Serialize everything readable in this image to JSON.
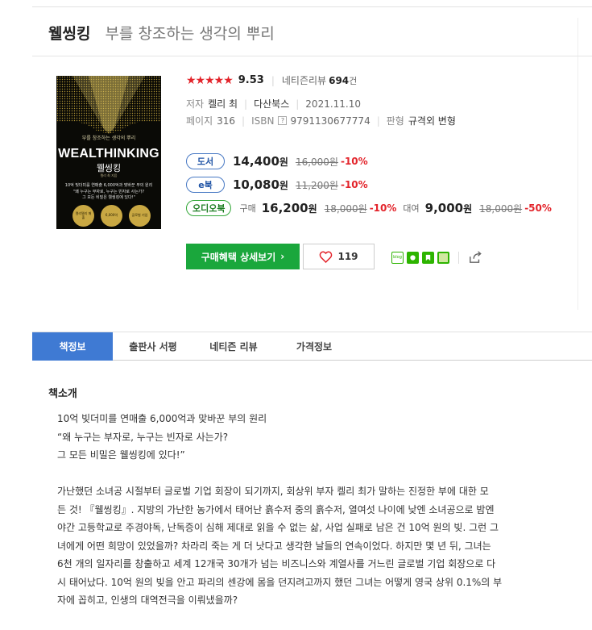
{
  "book": {
    "title": "웰씽킹",
    "subtitle": "부를 창조하는 생각의 뿌리"
  },
  "cover": {
    "small_text": "부를 창조하는 생각의 뿌리",
    "title_en": "WEALTHINKING",
    "title_kr": "웰씽킹",
    "author": "켈리 최 지음",
    "line1": "10억 빚더미를 연매출 6,000억과 맞바꾼 부의 원리",
    "line2": "\"왜 누구는 부자로, 누구는 빈자로 사는가?",
    "line3": "그 모든 비밀은 웰씽킹에 있다!\"",
    "badges": [
      "켈리델리 매출",
      "6,000억",
      "글로벌 기업"
    ]
  },
  "rating": {
    "stars": "★★★★★",
    "score": "9.53",
    "review_label": "네티즌리뷰",
    "review_count": "694",
    "review_unit": "건"
  },
  "meta": {
    "author_label": "저자",
    "author": "켈리 최",
    "publisher": "다산북스",
    "date": "2021.11.10",
    "pages_label": "페이지",
    "pages": "316",
    "isbn_label": "ISBN",
    "isbn_help": "?",
    "isbn": "9791130677774",
    "format_label": "판형",
    "format": "규격외 변형"
  },
  "prices": {
    "book": {
      "badge": "도서",
      "price": "14,400",
      "unit": "원",
      "original": "16,000원",
      "discount": "-10%"
    },
    "ebook": {
      "badge": "e북",
      "price": "10,080",
      "unit": "원",
      "original": "11,200원",
      "discount": "-10%"
    },
    "audio": {
      "badge": "오디오북",
      "buy_label": "구매",
      "buy_price": "16,200",
      "buy_unit": "원",
      "buy_original": "18,000원",
      "buy_discount": "-10%",
      "rent_label": "대여",
      "rent_price": "9,000",
      "rent_unit": "원",
      "rent_original": "18,000원",
      "rent_discount": "-50%"
    }
  },
  "actions": {
    "cta_label": "구매혜택 상세보기",
    "cta_arrow": "›",
    "like_count": "119",
    "blog_label": "blog"
  },
  "tabs": [
    "책정보",
    "출판사 서평",
    "네티즌 리뷰",
    "가격정보"
  ],
  "content": {
    "section_title": "책소개",
    "intro": [
      "10억 빚더미를 연매출 6,000억과 맞바꾼 부의 원리",
      "“왜 누구는 부자로, 누구는 빈자로 사는가?",
      "그 모든 비밀은 웰씽킹에 있다!”"
    ],
    "body": [
      "가난했던 소녀공 시절부터 글로벌 기업 회장이 되기까지, 회상위 부자 켈리 최가 말하는 진정한 부에 대한 모",
      "든 것! 『웰씽킹』. 지방의 가난한 농가에서 태어난 흙수저 중의 흙수저, 열여섯 나이에 낮엔 소녀공으로 밤엔",
      "야간 고등학교로 주경야독, 난독증이 심해 제대로 읽을 수 없는 삶, 사업 실패로 남은 건 10억 원의 빚. 그런 그",
      "녀에게 어떤 희망이 있었을까? 차라리 죽는 게 더 낫다고 생각한 날들의 연속이었다. 하지만 몇 년 뒤, 그녀는",
      "6천 개의 일자리를 창출하고 세계 12개국 30개가 넘는 비즈니스와 계열사를 거느린 글로벌 기업 회장으로 다",
      "시 태어났다. 10억 원의 빚을 안고 파리의 센강에 몸을 던지려고까지 했던 그녀는 어떻게 영국 상위 0.1%의 부",
      "자에 꼽히고, 인생의 대역전극을 이뤄냈을까?"
    ]
  }
}
